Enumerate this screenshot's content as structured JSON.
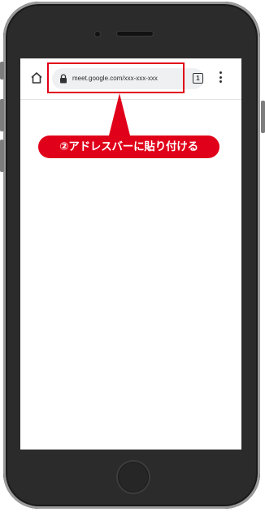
{
  "browser": {
    "url": "meet.google.com/xxx-xxx-xxx",
    "tab_count": "1",
    "icons": {
      "home": "home-icon",
      "lock": "lock-icon",
      "tabs": "tab-switcher-icon",
      "menu": "more-vert-icon"
    }
  },
  "annotation": {
    "label": "②アドレスバーに貼り付ける",
    "color": "#e00019"
  }
}
